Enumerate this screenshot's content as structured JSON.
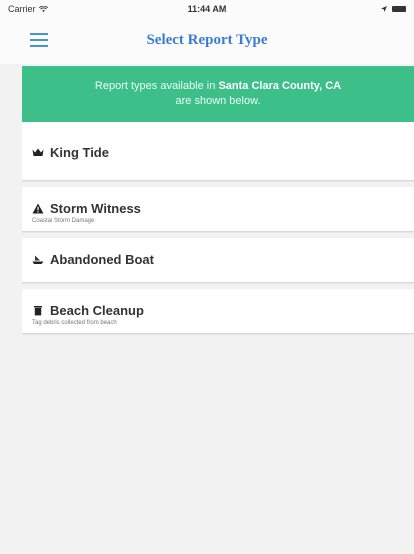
{
  "status_bar": {
    "carrier": "Carrier",
    "time": "11:44 AM"
  },
  "nav": {
    "title": "Select Report Type",
    "menu_icon": "hamburger-menu-icon"
  },
  "banner": {
    "prefix": "Report types available in",
    "location": "Santa Clara County, CA",
    "suffix": "are shown below."
  },
  "colors": {
    "accent": "#3a7bd5",
    "banner_bg": "#3dbf8a"
  },
  "reports": [
    {
      "label": "King Tide",
      "subtitle": "",
      "icon": "crown-icon"
    },
    {
      "label": "Storm Witness",
      "subtitle": "Coastal Storm Damage",
      "icon": "warning-icon"
    },
    {
      "label": "Abandoned Boat",
      "subtitle": "",
      "icon": "boat-icon"
    },
    {
      "label": "Beach Cleanup",
      "subtitle": "Tag debris collected from beach",
      "icon": "trash-icon"
    }
  ]
}
